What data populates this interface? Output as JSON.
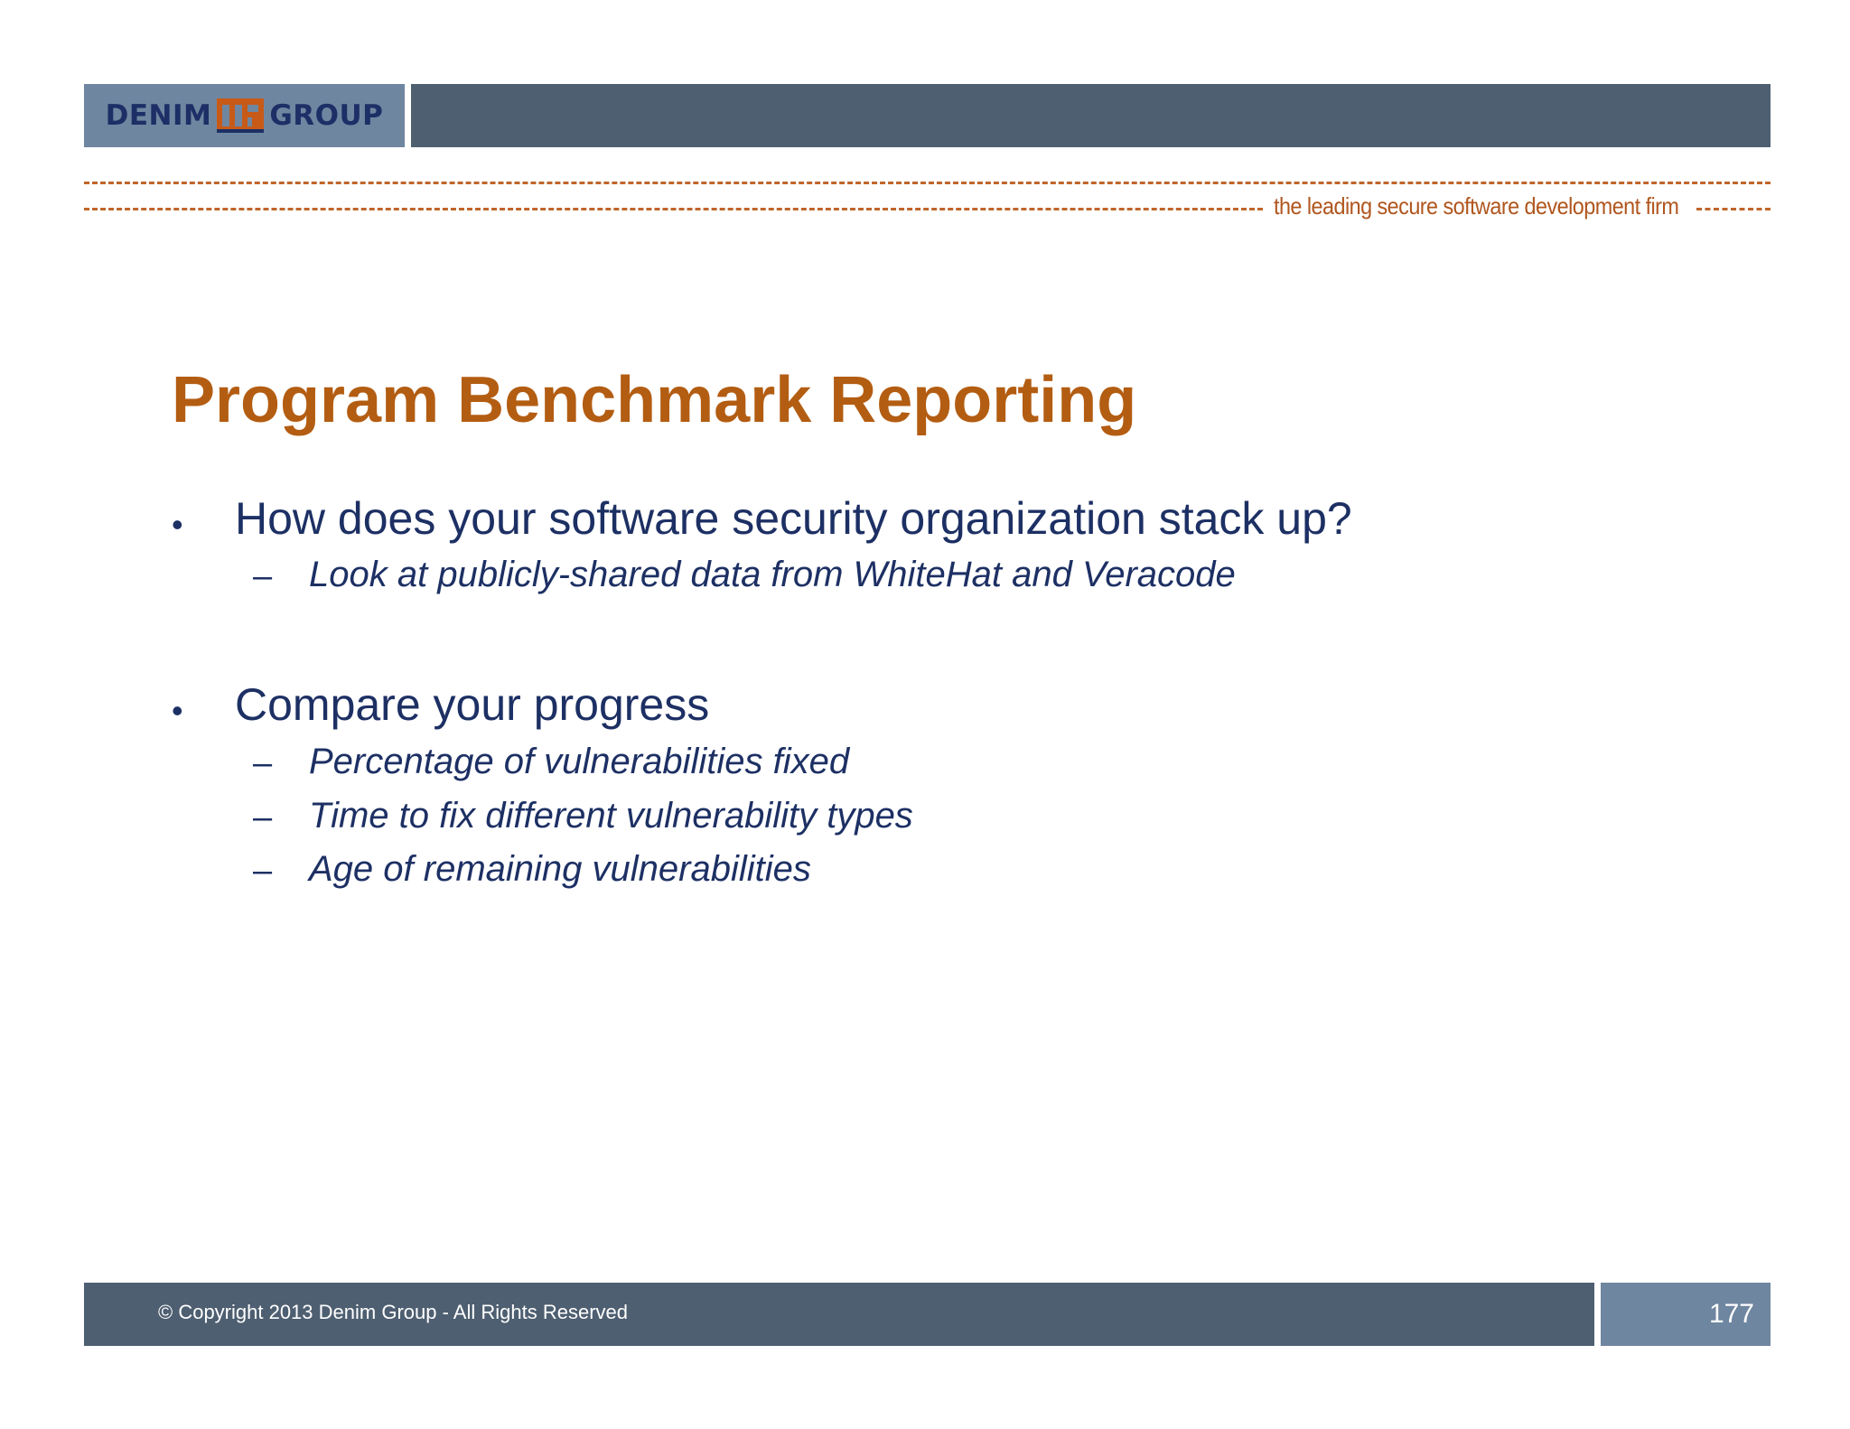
{
  "header": {
    "logo_left": "DENIM",
    "logo_right": "GROUP",
    "tagline": "the leading secure software development firm"
  },
  "slide": {
    "title": "Program Benchmark Reporting",
    "bullets": [
      {
        "text": "How does your software security organization stack up?",
        "subs": [
          "Look at publicly-shared data from WhiteHat and Veracode"
        ]
      },
      {
        "text": "Compare your progress",
        "subs": [
          "Percentage of vulnerabilities fixed",
          "Time to fix different vulnerability types",
          "Age of remaining vulnerabilities"
        ]
      }
    ],
    "bullet_glyph": "•",
    "sub_glyph": "–"
  },
  "footer": {
    "copyright": "© Copyright 2013  Denim Group - All Rights Reserved",
    "page_number": "177"
  },
  "colors": {
    "title": "#b35d12",
    "body_text": "#1d3064",
    "header_bar": "#4e5f71",
    "logo_box": "#6f86a0",
    "dash": "#c0652a"
  },
  "icons": {
    "logo_mark": "denim-group-logo-mark"
  }
}
